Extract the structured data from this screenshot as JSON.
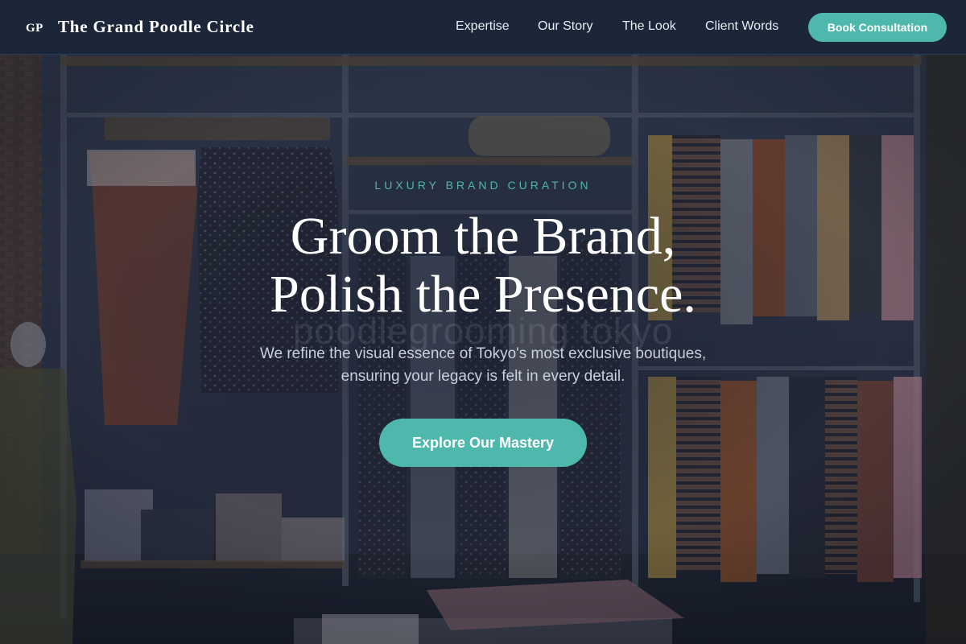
{
  "nav": {
    "logo_mark": "GP",
    "brand_name": "The Grand Poodle Circle",
    "links": [
      {
        "label": "Expertise"
      },
      {
        "label": "Our Story"
      },
      {
        "label": "The Look"
      },
      {
        "label": "Client Words"
      }
    ],
    "cta_label": "Book Consultation"
  },
  "hero": {
    "eyebrow": "LUXURY BRAND CURATION",
    "headline_line1": "Groom the Brand,",
    "headline_line2": "Polish the Presence.",
    "watermark": "poodlegrooming tokyo",
    "subtitle_line1": "We refine the visual essence of Tokyo's most exclusive boutiques,",
    "subtitle_line2": "ensuring your legacy is felt in every detail.",
    "cta_label": "Explore Our Mastery"
  },
  "background": {
    "image_subject": "boutique clothing racks photo",
    "tint_color": "#1b2638"
  },
  "colors": {
    "accent": "#4fb8ac",
    "eyebrow": "#52b5a9",
    "nav_bg": "#1b2638",
    "text": "#ffffff",
    "subtitle": "#c9cfdb"
  }
}
